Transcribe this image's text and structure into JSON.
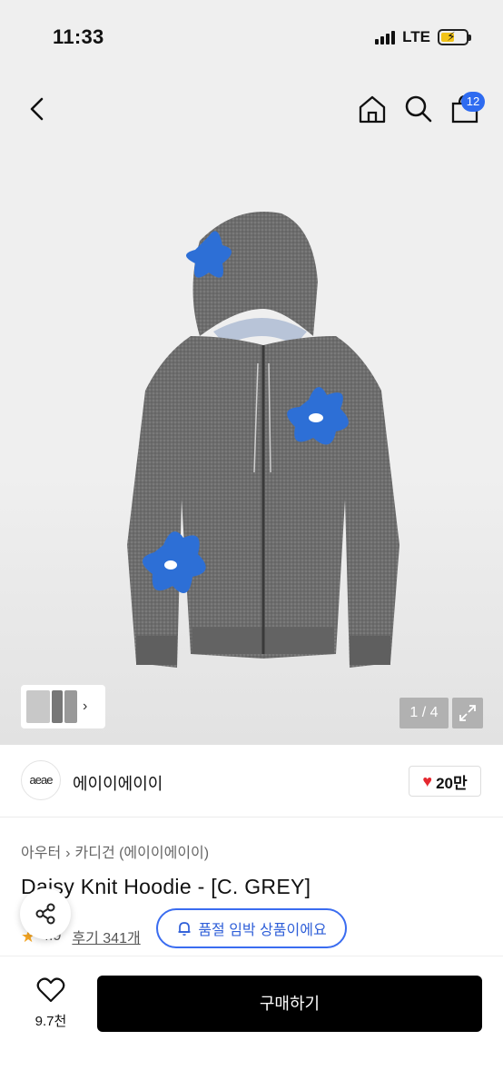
{
  "status_bar": {
    "time": "11:33",
    "network": "LTE"
  },
  "nav": {
    "cart_count": "12"
  },
  "gallery": {
    "counter": "1 / 4"
  },
  "brand": {
    "logo_text": "aeae",
    "name": "에이이에이이",
    "like_count": "20만"
  },
  "breadcrumb": {
    "category": "아우터",
    "subcategory": "카디건 (에이이에이이)"
  },
  "product": {
    "title": "Daisy Knit Hoodie - [C. GREY]",
    "rating": "4.9",
    "reviews": "후기 341개"
  },
  "stock_notice": "품절 임박 상품이에요",
  "bottom": {
    "wish_count": "9.7천",
    "buy_label": "구매하기"
  },
  "colors": {
    "accent_blue": "#2e6bf0",
    "buy_button": "#000000",
    "heart": "#e5282f",
    "star": "#f5a623"
  }
}
